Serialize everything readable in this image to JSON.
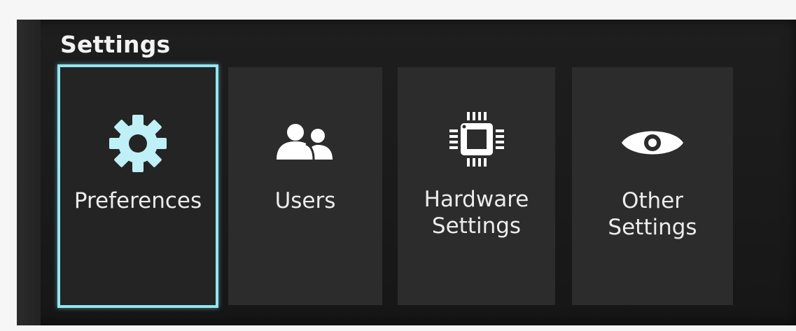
{
  "header": {
    "title": "Settings"
  },
  "tiles": [
    {
      "label": "Preferences",
      "icon": "gear-icon",
      "selected": true
    },
    {
      "label": "Users",
      "icon": "users-icon",
      "selected": false
    },
    {
      "label": "Hardware\nSettings",
      "icon": "chip-icon",
      "selected": false
    },
    {
      "label": "Other\nSettings",
      "icon": "eye-icon",
      "selected": false
    }
  ],
  "colors": {
    "selection_border": "#8fe6f3",
    "gear_icon": "#bff0f7",
    "icon": "#ffffff",
    "tile_background": "#2c2c2c",
    "screen_background": "#1c1c1c"
  }
}
